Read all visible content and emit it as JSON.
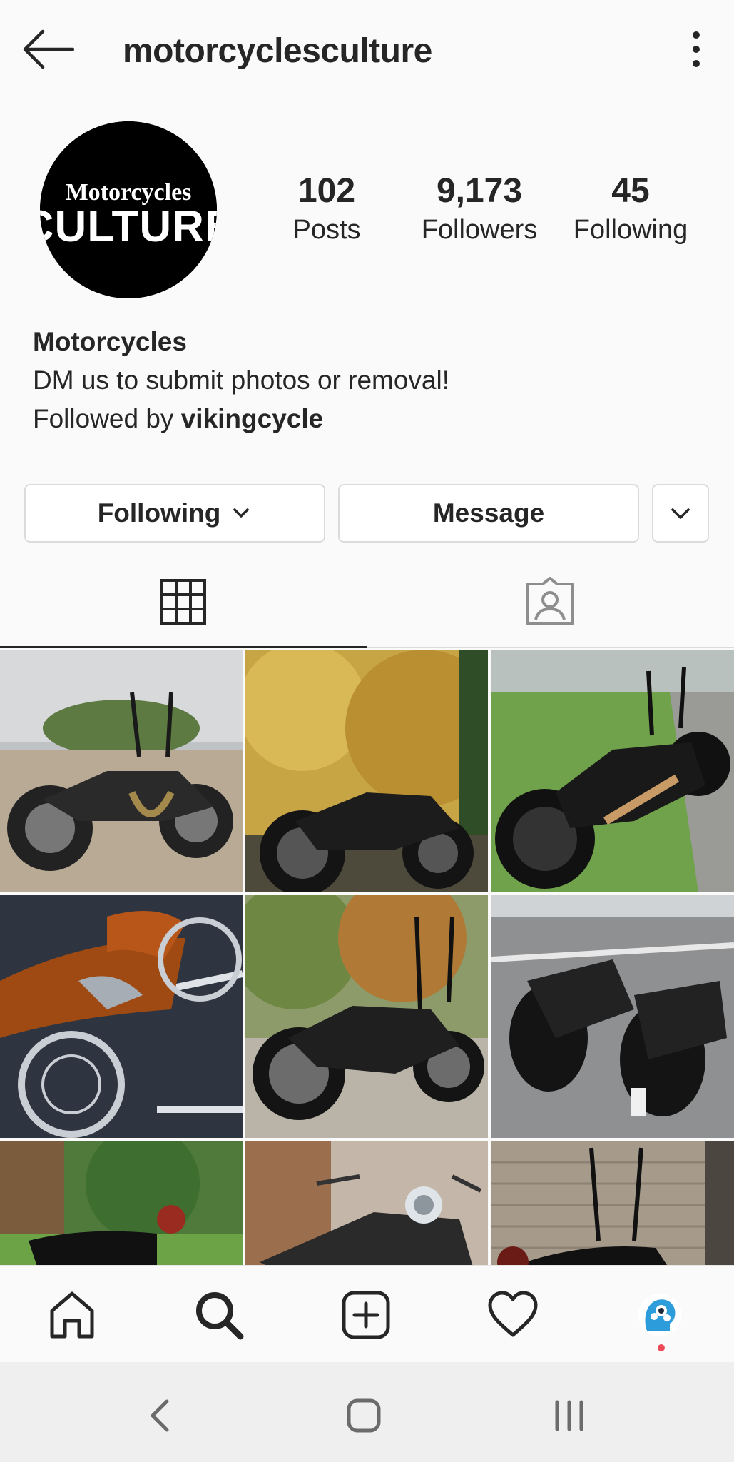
{
  "header": {
    "username": "motorcyclesculture"
  },
  "profile": {
    "avatar_text_line1": "Motorcycles",
    "avatar_text_line2": "CULTURE",
    "stats": [
      {
        "value": "102",
        "label": "Posts"
      },
      {
        "value": "9,173",
        "label": "Followers"
      },
      {
        "value": "45",
        "label": "Following"
      }
    ],
    "name": "Motorcycles",
    "bio": "DM us to submit photos or removal!",
    "followed_by_prefix": "Followed by ",
    "followed_by_user": "vikingcycle"
  },
  "actions": {
    "following_label": "Following",
    "message_label": "Message"
  },
  "tabs": [
    {
      "icon": "grid-icon",
      "active": true
    },
    {
      "icon": "tagged-icon",
      "active": false
    }
  ],
  "posts": [
    {
      "id": "post-1",
      "description": "Black bobber motorcycle on parking lot"
    },
    {
      "id": "post-2",
      "description": "Black cruiser in autumn trees"
    },
    {
      "id": "post-3",
      "description": "Black custom bike with fat rear tire on grass"
    },
    {
      "id": "post-4",
      "description": "Orange bagger with chrome wheel at night"
    },
    {
      "id": "post-5",
      "description": "Black bobber in autumn park"
    },
    {
      "id": "post-6",
      "description": "Two black muscle bikes on street"
    },
    {
      "id": "post-7",
      "description": "Black bike near building and trees"
    },
    {
      "id": "post-8",
      "description": "Chrome headlight cruiser"
    },
    {
      "id": "post-9",
      "description": "Black custom bike by garage door"
    }
  ],
  "bottom_nav": [
    "home-icon",
    "search-icon",
    "new-post-icon",
    "activity-heart-icon",
    "profile-avatar-icon"
  ],
  "colors": {
    "text": "#262626",
    "border": "#dbdbdb",
    "notification_dot": "#ed4956",
    "profile_icon_blue": "#2d9cdb"
  }
}
